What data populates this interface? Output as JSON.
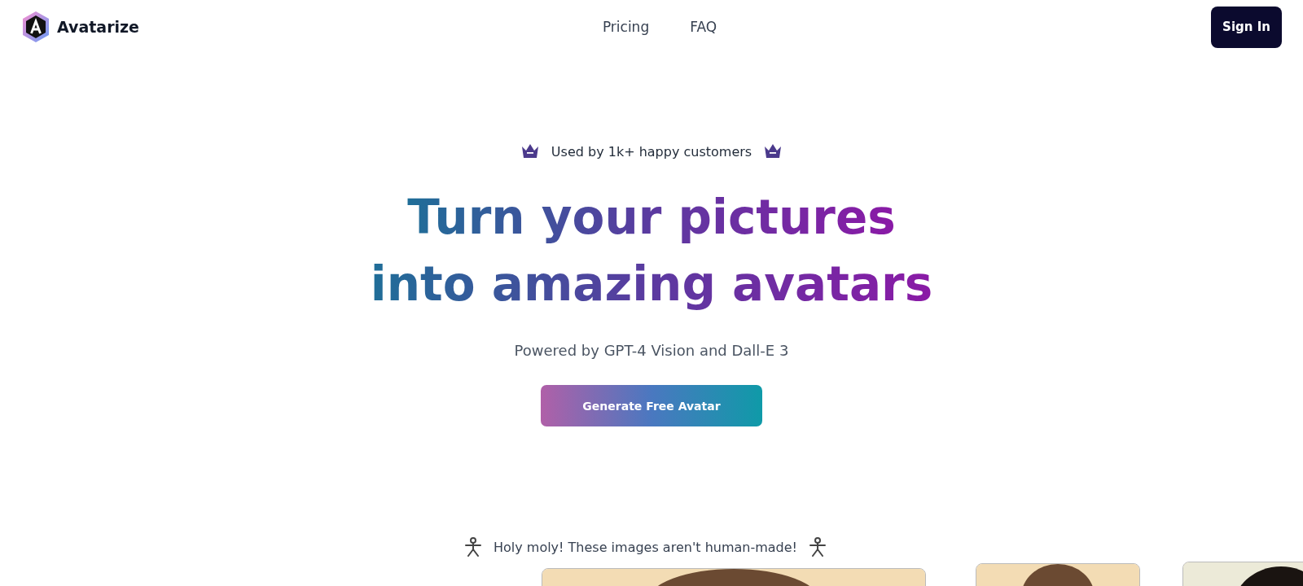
{
  "header": {
    "logo_text": "Avatarize",
    "nav": [
      "Pricing",
      "FAQ"
    ],
    "sign_in": "Sign In"
  },
  "hero": {
    "badge": "Used by 1k+ happy customers",
    "headline": [
      "Turn your pictures",
      "into amazing avatars"
    ],
    "subtitle": "Powered by GPT-4 Vision and Dall-E 3",
    "cta": "Generate Free Avatar"
  },
  "gallery": {
    "tagline": "Holy moly! These images aren't human-made!"
  }
}
